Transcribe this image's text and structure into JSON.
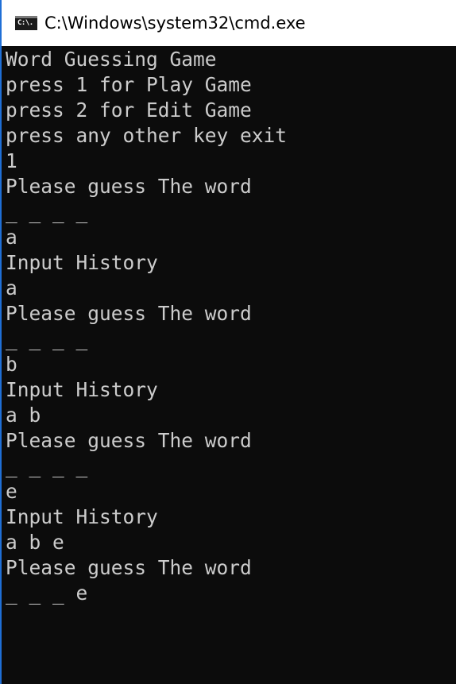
{
  "window": {
    "title": "C:\\Windows\\system32\\cmd.exe",
    "icon": "cmd-icon",
    "icon_text": "C:\\."
  },
  "colors": {
    "console_background": "#0c0c0c",
    "console_text": "#cccccc",
    "window_border": "#1f6fd6"
  },
  "console": {
    "lines": [
      "Word Guessing Game",
      "press 1 for Play Game",
      "press 2 for Edit Game",
      "press any other key exit",
      "1",
      "Please guess The word",
      "_ _ _ _",
      "a",
      "Input History",
      "a",
      "Please guess The word",
      "_ _ _ _",
      "b",
      "Input History",
      "a b",
      "Please guess The word",
      "_ _ _ _",
      "e",
      "Input History",
      "a b e",
      "Please guess The word",
      "_ _ _ e"
    ]
  }
}
